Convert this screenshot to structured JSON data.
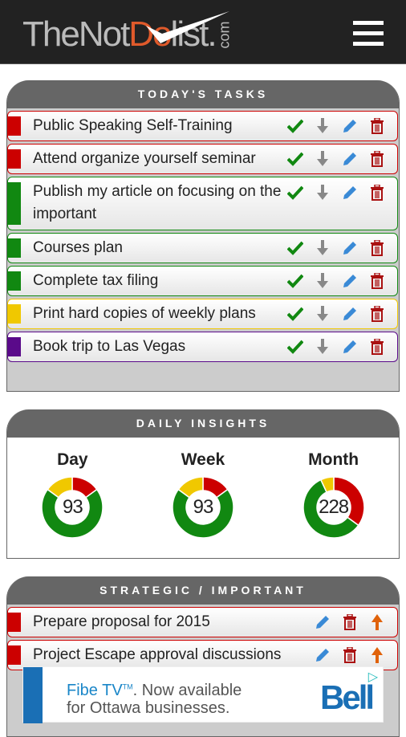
{
  "header": {
    "logo": "TheNotDoList.com",
    "logo_parts": [
      "TheNot",
      "Do",
      "list."
    ],
    "logo_tld": "com",
    "menu_icon": "hamburger-icon"
  },
  "colors": {
    "red": "#cc0000",
    "green": "#118811",
    "yellow": "#f0c800",
    "purple": "#5a0a8a",
    "header_bg": "#222222",
    "panel_head": "#666666",
    "edit": "#3a8ad6",
    "delete": "#aa1111",
    "up": "#e0620a"
  },
  "todays_tasks": {
    "title": "TODAY'S TASKS",
    "tasks": [
      {
        "label": "Public Speaking Self-Training",
        "priority": "red"
      },
      {
        "label": "Attend organize yourself seminar",
        "priority": "red"
      },
      {
        "label": "Publish my article on focusing on the important",
        "priority": "green"
      },
      {
        "label": "Courses plan",
        "priority": "green"
      },
      {
        "label": "Complete tax filing",
        "priority": "green"
      },
      {
        "label": "Print hard copies of weekly plans",
        "priority": "yellow"
      },
      {
        "label": "Book trip to Las Vegas",
        "priority": "purple"
      }
    ]
  },
  "insights": {
    "title": "DAILY INSIGHTS",
    "periods": [
      {
        "label": "Day",
        "total": "93",
        "segments": {
          "red": 15,
          "yellow": 15,
          "green": 70
        }
      },
      {
        "label": "Week",
        "total": "93",
        "segments": {
          "red": 15,
          "yellow": 15,
          "green": 70
        }
      },
      {
        "label": "Month",
        "total": "228",
        "segments": {
          "red": 35,
          "yellow": 7,
          "green": 58
        }
      }
    ]
  },
  "strategic": {
    "title": "STRATEGIC / IMPORTANT",
    "tasks": [
      {
        "label": "Prepare proposal for 2015",
        "priority": "red"
      },
      {
        "label": "Project Escape approval discussions",
        "priority": "red"
      }
    ]
  },
  "ad": {
    "line1_brand": "Fibe TV",
    "line1_tm": "TM",
    "line1_rest": ". Now available",
    "line2": "for Ottawa businesses.",
    "brand": "Bell"
  }
}
